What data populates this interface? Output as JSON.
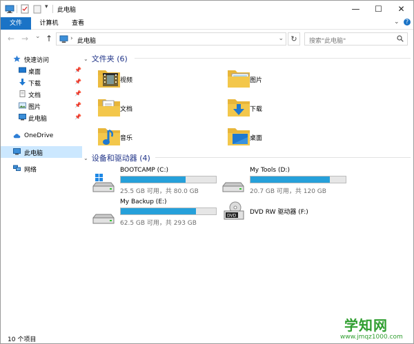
{
  "window": {
    "title": "此电脑",
    "minimize_glyph": "—",
    "maximize_glyph": "☐",
    "close_glyph": "✕"
  },
  "ribbon": {
    "tabs": [
      "文件",
      "计算机",
      "查看"
    ],
    "expand_glyph": "⌄",
    "help_glyph": "?"
  },
  "address": {
    "path": "此电脑",
    "search_placeholder": "搜索\"此电脑\"",
    "back_glyph": "←",
    "forward_glyph": "→",
    "history_glyph": "⌄",
    "up_glyph": "↑",
    "refresh_glyph": "↻",
    "chevron_glyph": "›",
    "dropdown_glyph": "⌄",
    "search_icon": "search-icon"
  },
  "sidebar": {
    "quick_access": "快速访问",
    "quick_items": [
      {
        "label": "桌面",
        "icon": "desktop-icon"
      },
      {
        "label": "下载",
        "icon": "download-icon"
      },
      {
        "label": "文档",
        "icon": "document-icon"
      },
      {
        "label": "图片",
        "icon": "pictures-icon"
      },
      {
        "label": "此电脑",
        "icon": "computer-icon"
      }
    ],
    "onedrive": "OneDrive",
    "this_pc": "此电脑",
    "network": "网络",
    "pin_glyph": "📌"
  },
  "main": {
    "folders_header": "文件夹 (6)",
    "folders": [
      {
        "label": "视频",
        "icon": "videos-folder-icon"
      },
      {
        "label": "图片",
        "icon": "pictures-folder-icon"
      },
      {
        "label": "文档",
        "icon": "documents-folder-icon"
      },
      {
        "label": "下载",
        "icon": "downloads-folder-icon"
      },
      {
        "label": "音乐",
        "icon": "music-folder-icon"
      },
      {
        "label": "桌面",
        "icon": "desktop-folder-icon"
      }
    ],
    "drives_header": "设备和驱动器 (4)",
    "drives": [
      {
        "name": "BOOTCAMP (C:)",
        "info": "25.5 GB 可用，共 80.0 GB",
        "used_fraction": 0.68,
        "icon": "windows-drive-icon"
      },
      {
        "name": "My Tools (D:)",
        "info": "20.7 GB 可用，共 120 GB",
        "used_fraction": 0.83,
        "icon": "hard-drive-icon"
      },
      {
        "name": "My Backup (E:)",
        "info": "62.5 GB 可用，共 293 GB",
        "used_fraction": 0.79,
        "icon": "hard-drive-icon"
      },
      {
        "name": "DVD RW 驱动器 (F:)",
        "info": "",
        "used_fraction": null,
        "icon": "dvd-drive-icon"
      }
    ],
    "collapse_glyph": "⌄"
  },
  "status": {
    "item_count": "10 个项目"
  },
  "watermark": {
    "text": "学知网",
    "url": "www.jmqz1000.com"
  },
  "colors": {
    "accent": "#1a73c6",
    "selection": "#cce8ff",
    "header_text": "#1e3287",
    "progress": "#26a0da",
    "folder_yellow": "#f3c74b"
  }
}
